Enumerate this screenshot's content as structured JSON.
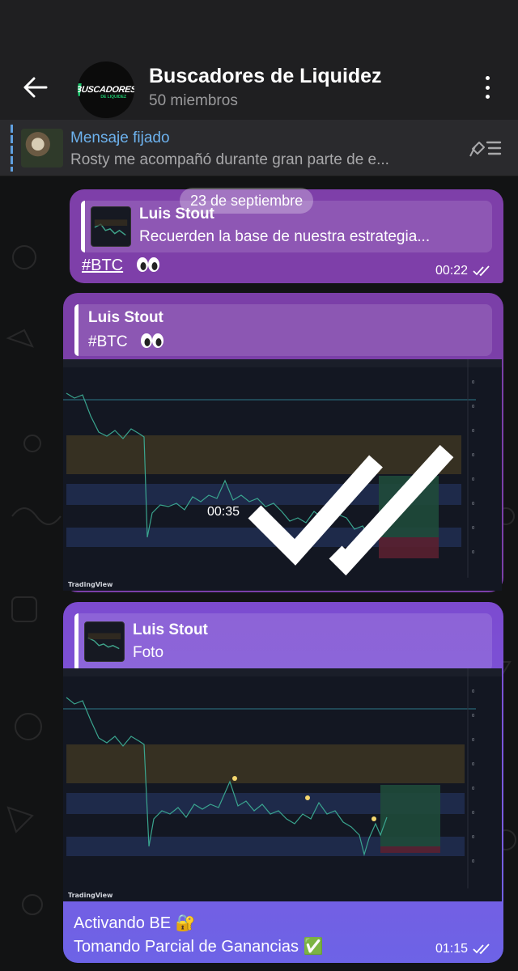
{
  "header": {
    "title": "Buscadores de Liquidez",
    "subtitle": "50 miembros",
    "avatar_text": "BUSCADORES",
    "avatar_subtext": "DE LIQUIDEZ"
  },
  "pinned": {
    "title": "Mensaje fijado",
    "text": "Rosty me acompañó durante gran parte de e..."
  },
  "date_separator": "23 de septiembre",
  "messages": [
    {
      "reply_name": "Luis Stout",
      "reply_text": "Recuerden la base de nuestra estrategia...",
      "text": "#BTC",
      "emoji": "eyes",
      "time": "00:22"
    },
    {
      "reply_name": "Luis Stout",
      "reply_text": "#BTC",
      "reply_emoji": "eyes",
      "image_footer": "TradingView",
      "time": "00:35"
    },
    {
      "reply_name": "Luis Stout",
      "reply_text": "Foto",
      "image_footer": "TradingView",
      "text_line1": "Activando BE 🔐",
      "text_line2": "Tomando Parcial de Ganancias ✅",
      "time": "01:15"
    }
  ],
  "colors": {
    "topbar": "#1f1f21",
    "bubble_purple": "#7b3fa8",
    "bubble_violet": "#7a5be0",
    "pinned_title": "#6db2ee"
  }
}
